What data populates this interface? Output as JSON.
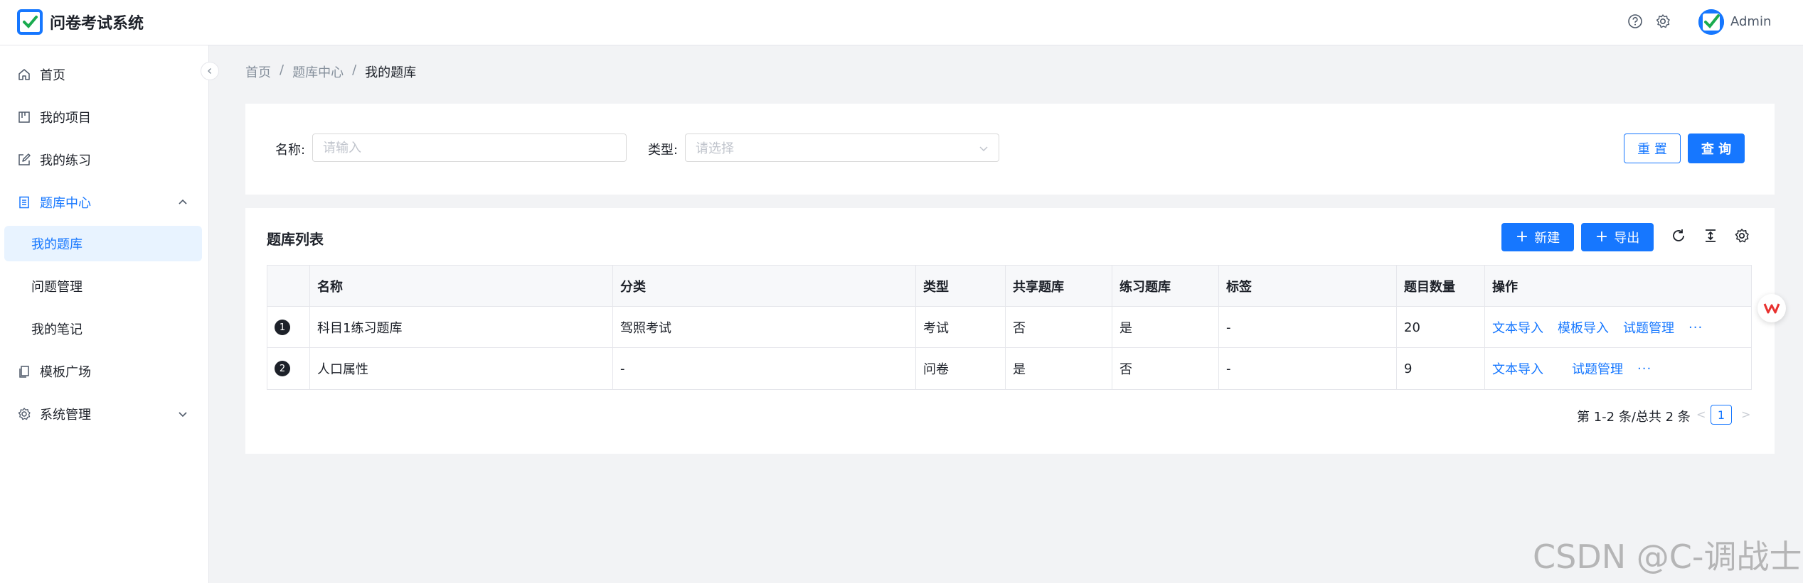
{
  "app": {
    "title": "问卷考试系统",
    "user": "Admin"
  },
  "sidebar": {
    "items": [
      {
        "label": "首页"
      },
      {
        "label": "我的项目"
      },
      {
        "label": "我的练习"
      },
      {
        "label": "题库中心"
      },
      {
        "label": "我的题库"
      },
      {
        "label": "问题管理"
      },
      {
        "label": "我的笔记"
      },
      {
        "label": "模板广场"
      },
      {
        "label": "系统管理"
      }
    ]
  },
  "breadcrumb": {
    "items": [
      "首页",
      "题库中心",
      "我的题库"
    ],
    "separator": "/"
  },
  "search": {
    "name_label": "名称:",
    "name_placeholder": "请输入",
    "type_label": "类型:",
    "type_placeholder": "请选择",
    "reset_label": "重 置",
    "query_label": "查 询"
  },
  "table_card": {
    "title": "题库列表",
    "new_label": "新建",
    "export_label": "导出",
    "columns": [
      "名称",
      "分类",
      "类型",
      "共享题库",
      "练习题库",
      "标签",
      "题目数量",
      "操作"
    ],
    "rows": [
      {
        "index": "1",
        "name": "科目1练习题库",
        "category": "驾照考试",
        "type": "考试",
        "shared": "否",
        "practice": "是",
        "tags": "-",
        "count": "20",
        "actions": [
          "文本导入",
          "模板导入",
          "试题管理"
        ],
        "more": "···"
      },
      {
        "index": "2",
        "name": "人口属性",
        "category": "-",
        "type": "问卷",
        "shared": "是",
        "practice": "否",
        "tags": "-",
        "count": "9",
        "actions": [
          "文本导入",
          "试题管理"
        ],
        "more": "···"
      }
    ]
  },
  "pagination": {
    "summary": "第 1-2 条/总共 2 条",
    "current_page": "1",
    "prev": "<",
    "next": ">"
  },
  "watermark": "CSDN @C-调战士",
  "colors": {
    "primary": "#1677ff",
    "background": "#f2f3f5",
    "text": "#1d2129"
  }
}
